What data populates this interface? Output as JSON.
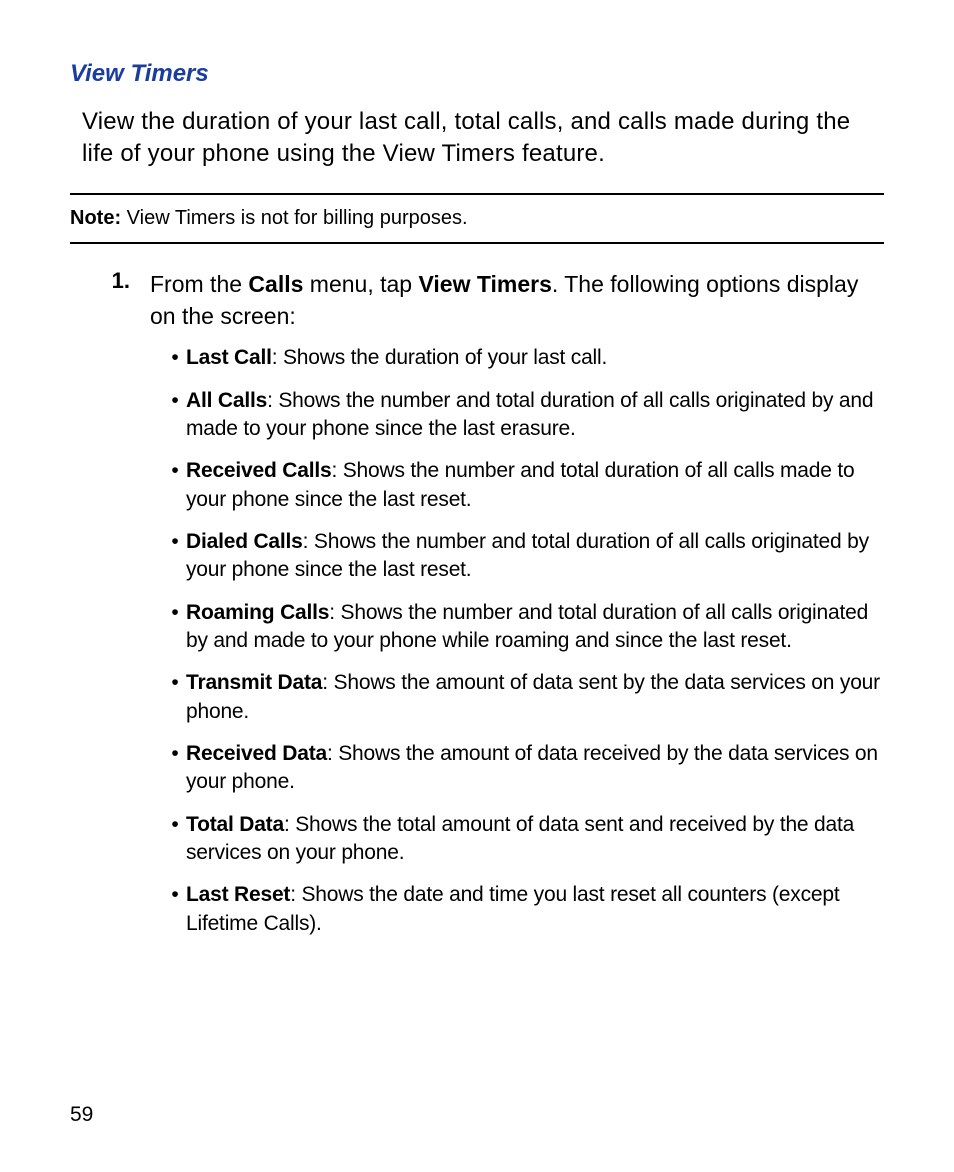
{
  "heading": "View Timers",
  "intro": "View the duration of your last call, total calls, and calls made during the life of your phone using the View Timers feature.",
  "note": {
    "label": "Note:",
    "text": " View Timers is not for billing purposes."
  },
  "step": {
    "number": "1.",
    "pre": "From the ",
    "bold1": "Calls",
    "mid": " menu, tap ",
    "bold2": "View Timers",
    "post": ". The following options display on the screen:"
  },
  "bullets": [
    {
      "term": "Last Call",
      "desc": ": Shows the duration of your last call."
    },
    {
      "term": "All Calls",
      "desc": ": Shows the number and total duration of all calls originated by and made to your phone since the last erasure."
    },
    {
      "term": "Received Calls",
      "desc": ": Shows the number and total duration of all calls made to your phone since the last reset."
    },
    {
      "term": "Dialed Calls",
      "desc": ": Shows the number and total duration of all calls originated by your phone since the last reset."
    },
    {
      "term": "Roaming Calls",
      "desc": ": Shows the number and total duration of all calls originated by and made to your phone while roaming and since the last reset."
    },
    {
      "term": "Transmit Data",
      "desc": ": Shows the amount of data sent by the data services on your phone."
    },
    {
      "term": "Received Data",
      "desc": ": Shows the amount of data received by the data services on your phone."
    },
    {
      "term": "Total Data",
      "desc": ": Shows the total amount of data sent and received by the data services on your phone."
    },
    {
      "term": "Last Reset",
      "desc": ": Shows the date and time you last reset all counters (except Lifetime Calls)."
    }
  ],
  "pageNumber": "59"
}
